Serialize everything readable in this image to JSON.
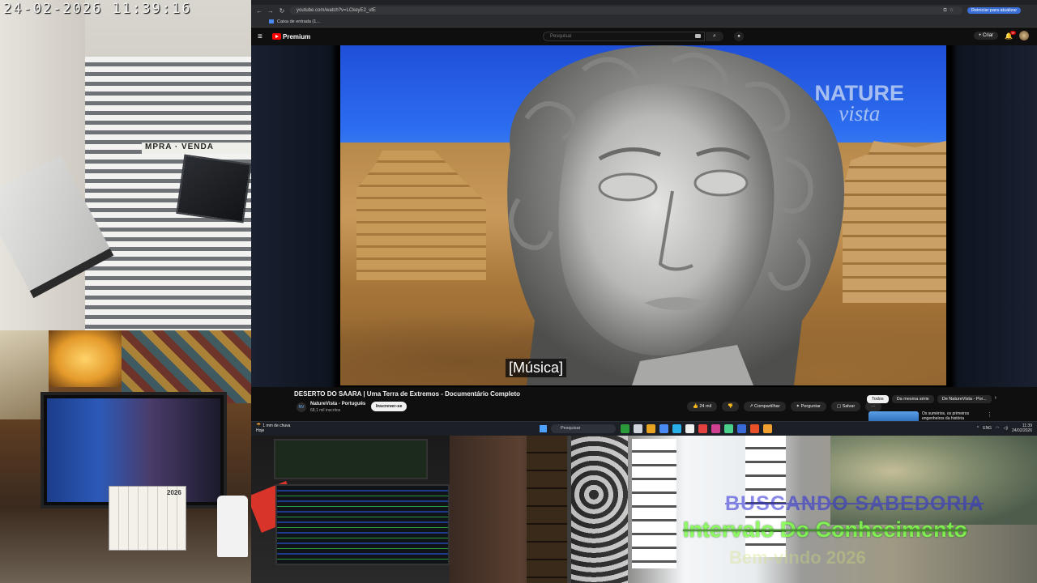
{
  "camera": {
    "timestamp": "24-02-2026 11:39:16",
    "sign_text": "MPRA · VENDA",
    "calendar_year": "2026"
  },
  "overlay": {
    "line1": "BUSCANDO SABEDORIA",
    "line2": "Intervalo Do Conhecimento",
    "line3": "Bem-vindo 2026"
  },
  "browser": {
    "url": "youtube.com/watch?v=LCkeyE2_vtE",
    "restart_label": "Reiniciar para atualizar",
    "bookmark": "Caixa de entrada (1..."
  },
  "youtube": {
    "logo_text": "Premium",
    "search_placeholder": "Pesquisar",
    "create_label": "Criar",
    "notif_count": "9+",
    "video": {
      "watermark_line1": "NATURE",
      "watermark_line2": "vista",
      "caption": "[Música]",
      "title": "DESERTO DO SAARA | Uma Terra de Extremos - Documentário Completo"
    },
    "channel": {
      "name": "NatureVista - Português",
      "subs": "68,1 mil inscritos",
      "avatar_text": "NV"
    },
    "subscribe_label": "Inscrever-se",
    "actions": [
      {
        "name": "like",
        "label": "👍 24 mil"
      },
      {
        "name": "dislike",
        "label": "👎"
      },
      {
        "name": "share",
        "label": "↗ Compartilhar"
      },
      {
        "name": "ask",
        "label": "✦ Perguntar"
      },
      {
        "name": "save",
        "label": "▢ Salvar"
      },
      {
        "name": "more",
        "label": "···"
      }
    ],
    "chips": [
      {
        "label": "Todos",
        "active": true
      },
      {
        "label": "Da mesma série",
        "active": false
      },
      {
        "label": "De NatureVista - Por...",
        "active": false
      }
    ],
    "recommendation_title": "Os sumérios, os primeiros engenheiros da história"
  },
  "taskbar": {
    "weather": "1 mm de chuva",
    "weather_sub": "Hoje",
    "search_label": "Pesquisar",
    "lang": "ENG",
    "time": "11:39",
    "date": "24/02/2026",
    "app_colors": [
      "#2a9a3a",
      "#cfd3da",
      "#e8a420",
      "#4a8af4",
      "#2ab0e8",
      "#f1f1f1",
      "#e44040",
      "#d04090",
      "#4ad08a",
      "#3a6ad8",
      "#e8502a",
      "#f0a030"
    ]
  }
}
